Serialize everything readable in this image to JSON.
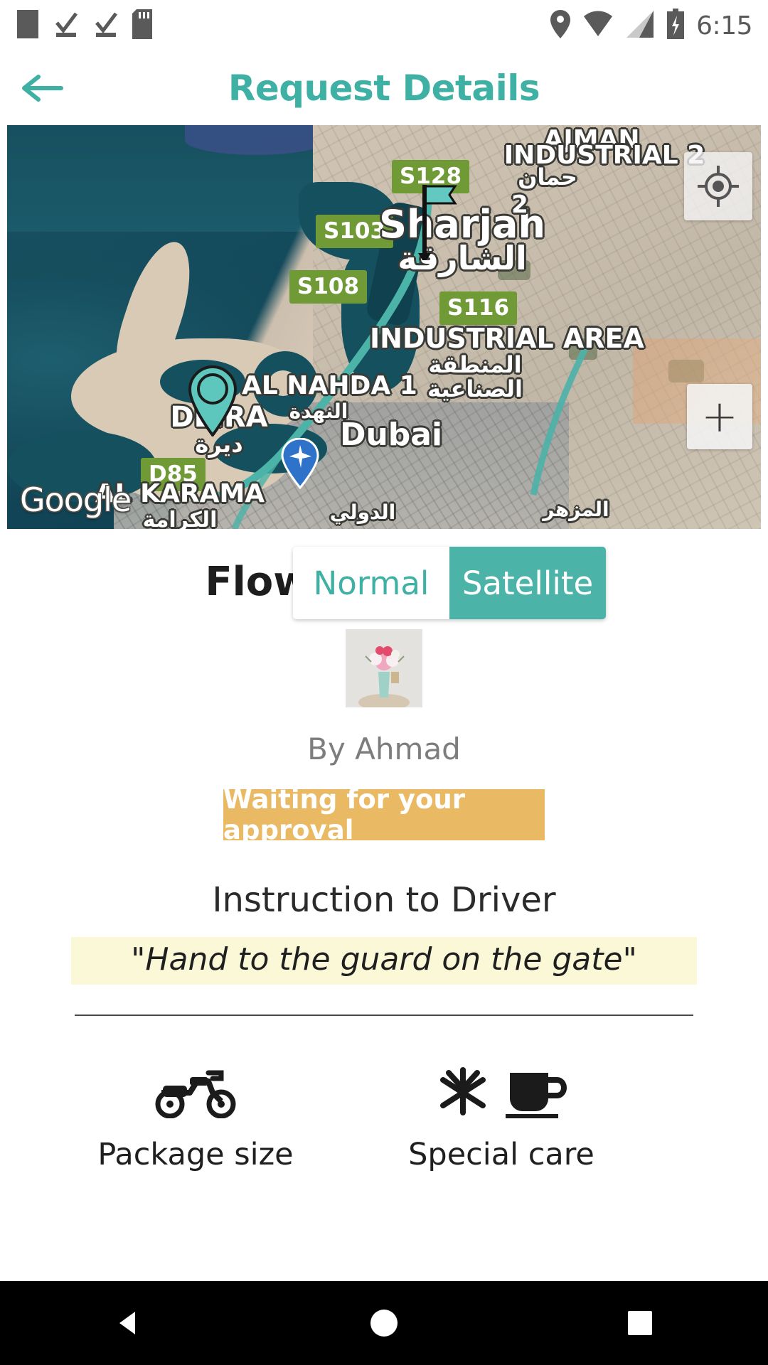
{
  "status_bar": {
    "time": "6:15",
    "left_icons": [
      "screenshot-icon",
      "task-done-icon",
      "task-done-icon",
      "sd-card-icon"
    ],
    "right_icons": [
      "location-icon",
      "wifi-icon",
      "signal-icon",
      "battery-charging-icon"
    ]
  },
  "header": {
    "title": "Request Details",
    "back_label": "Back",
    "accent_color": "#3fb0a4"
  },
  "map": {
    "provider_logo": "Google",
    "type_toggle": {
      "options": [
        "Normal",
        "Satellite"
      ],
      "selected": "Satellite"
    },
    "zoom_in_label": "+",
    "road_shields": [
      "S128",
      "S103",
      "S108",
      "S116",
      "D85"
    ],
    "place_labels": [
      {
        "name": "AJMAN",
        "sub": "INDUSTRIAL 2"
      },
      {
        "name": "Sharjah",
        "sub": "الشارقة"
      },
      {
        "name": "INDUSTRIAL AREA",
        "sub": "المنطقة"
      },
      {
        "name": "الصناعية",
        "sub": ""
      },
      {
        "name": "AL NAHDA 1",
        "sub": "النهدة"
      },
      {
        "name": "DEIRA",
        "sub": "ديرة"
      },
      {
        "name": "Dubai",
        "sub": ""
      },
      {
        "name": "AL KARAMA",
        "sub": "الكرامة"
      },
      {
        "name": "حمان",
        "sub": "2"
      },
      {
        "name": "المزهر",
        "sub": ""
      },
      {
        "name": "الدولي",
        "sub": ""
      }
    ]
  },
  "request": {
    "title": "Flowers to Mom",
    "thumbnail_alt": "flower-bouquet-photo",
    "by_line": "By Ahmad",
    "status": "Waiting for your approval",
    "status_color": "#eab963",
    "instruction_heading": "Instruction to Driver",
    "instruction_text": "\"Hand to the guard on the gate\"",
    "features": [
      {
        "icon": "motorcycle-icon",
        "label": "Package size"
      },
      {
        "icon": "snowflake-cup-icon",
        "label": "Special care"
      }
    ]
  },
  "nav_bar": {
    "items": [
      "back-triangle",
      "home-circle",
      "recents-square"
    ]
  }
}
